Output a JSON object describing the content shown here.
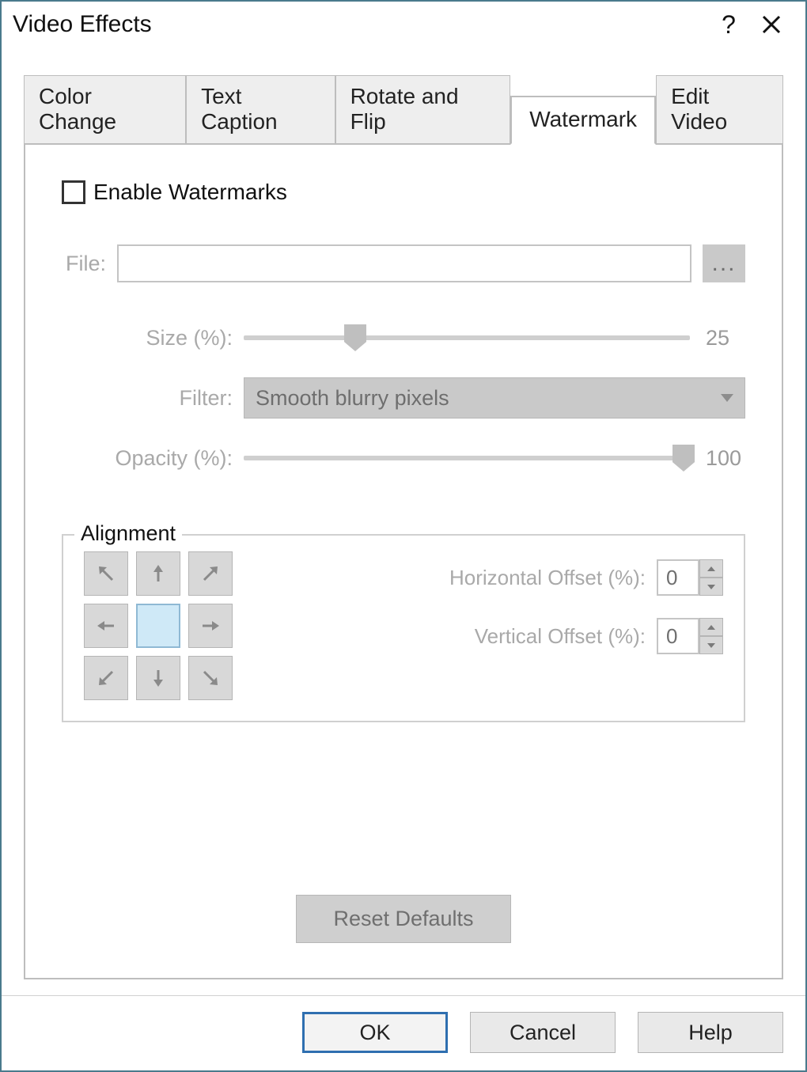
{
  "window": {
    "title": "Video Effects"
  },
  "tabs": {
    "items": [
      {
        "label": "Color Change"
      },
      {
        "label": "Text Caption"
      },
      {
        "label": "Rotate and Flip"
      },
      {
        "label": "Watermark"
      },
      {
        "label": "Edit Video"
      }
    ],
    "active_index": 3
  },
  "watermark": {
    "enable_label": "Enable Watermarks",
    "enable_checked": false,
    "file_label": "File:",
    "file_value": "",
    "browse_label": "...",
    "size_label": "Size (%):",
    "size_value": "25",
    "size_percent": 25,
    "filter_label": "Filter:",
    "filter_value": "Smooth blurry pixels",
    "opacity_label": "Opacity (%):",
    "opacity_value": "100",
    "opacity_percent": 100,
    "alignment": {
      "legend": "Alignment",
      "selected_index": 4,
      "h_offset_label": "Horizontal Offset (%):",
      "h_offset_value": "0",
      "v_offset_label": "Vertical Offset (%):",
      "v_offset_value": "0"
    },
    "reset_label": "Reset Defaults"
  },
  "buttons": {
    "ok": "OK",
    "cancel": "Cancel",
    "help": "Help"
  }
}
